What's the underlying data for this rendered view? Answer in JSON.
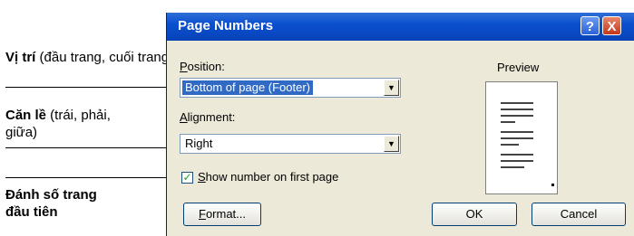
{
  "annotations": {
    "position_bold": "Vị trí",
    "position_rest": " (đầu trang, cuối trang)",
    "alignment_bold": "Căn lề",
    "alignment_rest": " (trái, phải, giữa)",
    "firstpage_line1": "Đánh số trang",
    "firstpage_line2": "đầu tiên"
  },
  "dialog": {
    "title": "Page Numbers",
    "help_label": "?",
    "close_label": "X",
    "position": {
      "label_u": "P",
      "label_rest": "osition:",
      "value": "Bottom of page (Footer)"
    },
    "alignment": {
      "label_u": "A",
      "label_rest": "lignment:",
      "value": "Right"
    },
    "show_first": {
      "label_u": "S",
      "label_rest": "how number on first page",
      "checked": true
    },
    "preview_label": "Preview",
    "buttons": {
      "format_u": "F",
      "format_rest": "ormat...",
      "ok": "OK",
      "cancel": "Cancel"
    }
  },
  "colors": {
    "titlebar": "#0a4fd0",
    "dialog_bg": "#ece9d8",
    "selection": "#316ac5"
  }
}
